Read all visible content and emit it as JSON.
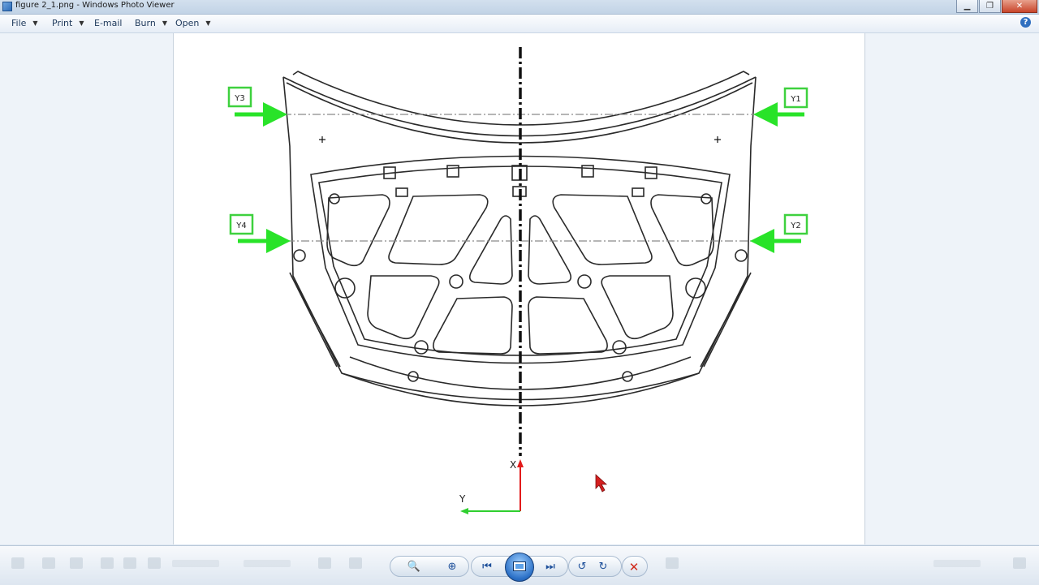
{
  "window": {
    "title": "figure 2_1.png - Windows Photo Viewer",
    "app_icon": "photo-viewer-icon",
    "controls": {
      "minimize": "▁",
      "maximize": "❐",
      "close": "✕"
    }
  },
  "menu": {
    "file": "File",
    "print": "Print",
    "email": "E-mail",
    "burn": "Burn",
    "open": "Open",
    "help": "?"
  },
  "figure": {
    "labels": {
      "y1": "Y1",
      "y2": "Y2",
      "y3": "Y3",
      "y4": "Y4",
      "x_axis": "X",
      "y_axis": "Y"
    },
    "colors": {
      "label_box": "#3ed13e",
      "arrow": "#29e329",
      "x_axis": "#e21b1b",
      "y_axis": "#2fcf2f",
      "line": "#2a2a2a"
    }
  },
  "toolbar": {
    "zoom": "🔍",
    "fit": "⊕",
    "previous": "⏮",
    "slideshow": "slideshow",
    "next": "⏭",
    "rotate_ccw": "↺",
    "rotate_cw": "↻",
    "delete": "✕"
  }
}
